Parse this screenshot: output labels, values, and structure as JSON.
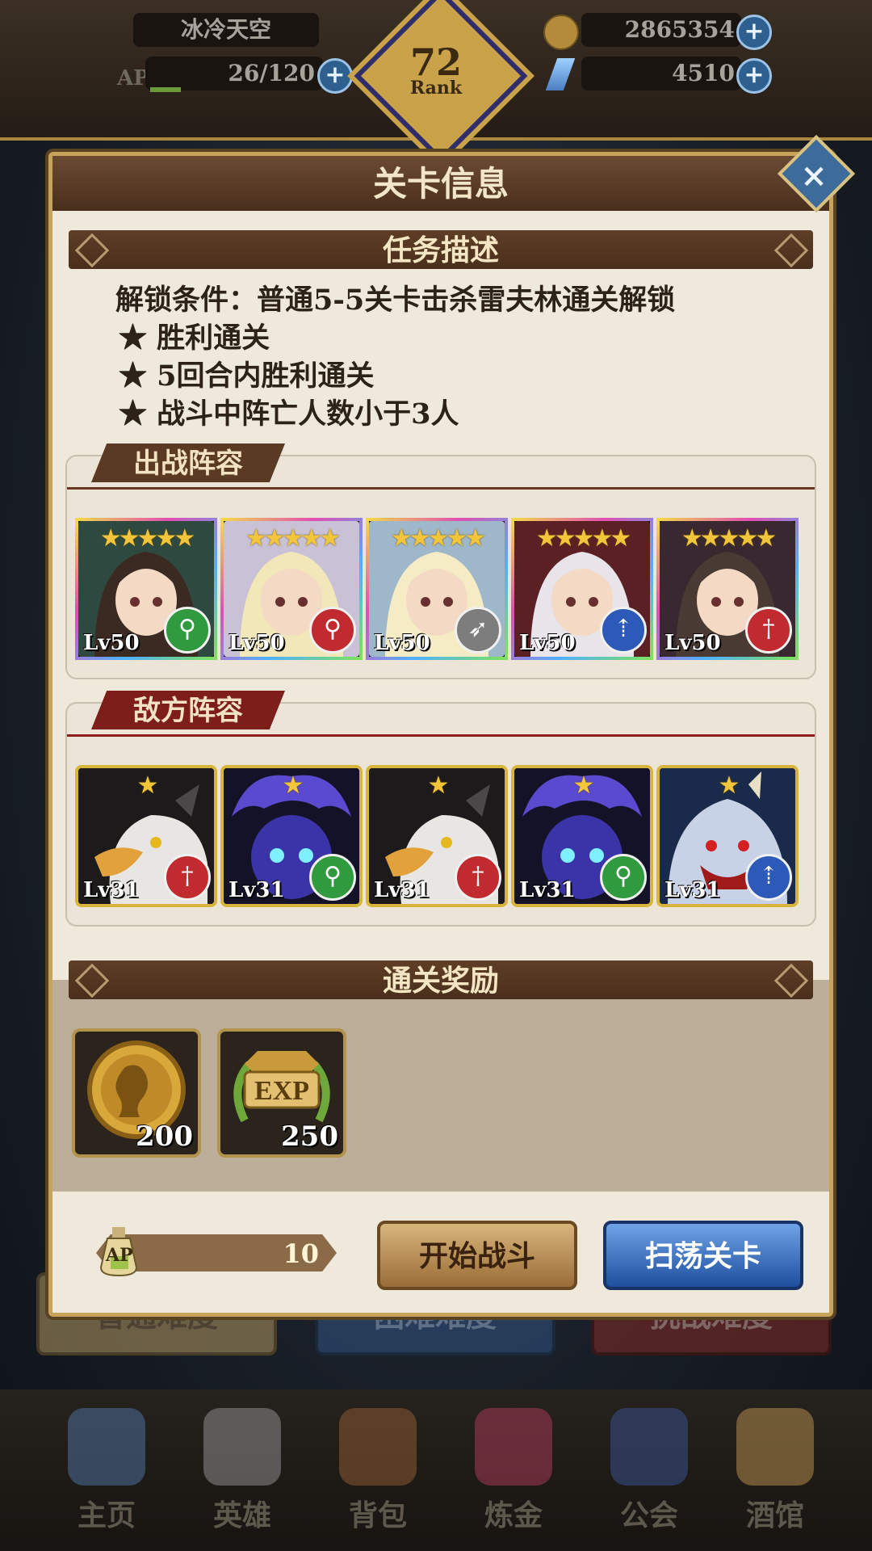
{
  "hud": {
    "player_name": "冰冷天空",
    "ap_label": "AP",
    "ap_value": "26/120",
    "rank_number": "72",
    "rank_label": "Rank",
    "gold": "2865354",
    "crystals": "4510"
  },
  "background": {
    "difficulties": [
      "普通难度",
      "困难难度",
      "挑战难度"
    ]
  },
  "dialog": {
    "title": "关卡信息",
    "task_header": "任务描述",
    "unlock_condition": "解锁条件：普通5-5关卡击杀雷夫林通关解锁",
    "objectives": [
      "★ 胜利通关",
      "★ 5回合内胜利通关",
      "★ 战斗中阵亡人数小于3人"
    ],
    "ally_header": "出战阵容",
    "enemy_header": "敌方阵容",
    "rewards_header": "通关奖励",
    "allies": [
      {
        "level": "Lv50",
        "class_icon": "staff-icon",
        "class_color": "#2f9a3e",
        "stars": "★★★★★"
      },
      {
        "level": "Lv50",
        "class_icon": "staff-icon",
        "class_color": "#c12a2e",
        "stars": "★★★★★"
      },
      {
        "level": "Lv50",
        "class_icon": "bow-icon",
        "class_color": "#7d7d7d",
        "stars": "★★★★★"
      },
      {
        "level": "Lv50",
        "class_icon": "spear-icon",
        "class_color": "#2d59b8",
        "stars": "★★★★★"
      },
      {
        "level": "Lv50",
        "class_icon": "sword-icon",
        "class_color": "#c12a2e",
        "stars": "★★★★★"
      }
    ],
    "enemies": [
      {
        "level": "Lv31",
        "class_icon": "sword-icon",
        "class_color": "#c12a2e",
        "stars": "★",
        "portrait": "griffin"
      },
      {
        "level": "Lv31",
        "class_icon": "staff-icon",
        "class_color": "#2f9a3e",
        "stars": "★",
        "portrait": "spirit"
      },
      {
        "level": "Lv31",
        "class_icon": "sword-icon",
        "class_color": "#c12a2e",
        "stars": "★",
        "portrait": "griffin"
      },
      {
        "level": "Lv31",
        "class_icon": "staff-icon",
        "class_color": "#2f9a3e",
        "stars": "★",
        "portrait": "spirit"
      },
      {
        "level": "Lv31",
        "class_icon": "spear-icon",
        "class_color": "#2d59b8",
        "stars": "★",
        "portrait": "wolf"
      }
    ],
    "rewards": [
      {
        "type": "gold-coin-icon",
        "amount": "200"
      },
      {
        "type": "exp-badge-icon",
        "amount": "250"
      }
    ],
    "ap_cost_label": "AP",
    "ap_cost": "10",
    "start_button": "开始战斗",
    "sweep_button": "扫荡关卡"
  },
  "nav": {
    "items": [
      "主页",
      "英雄",
      "背包",
      "炼金",
      "公会",
      "酒馆"
    ]
  }
}
